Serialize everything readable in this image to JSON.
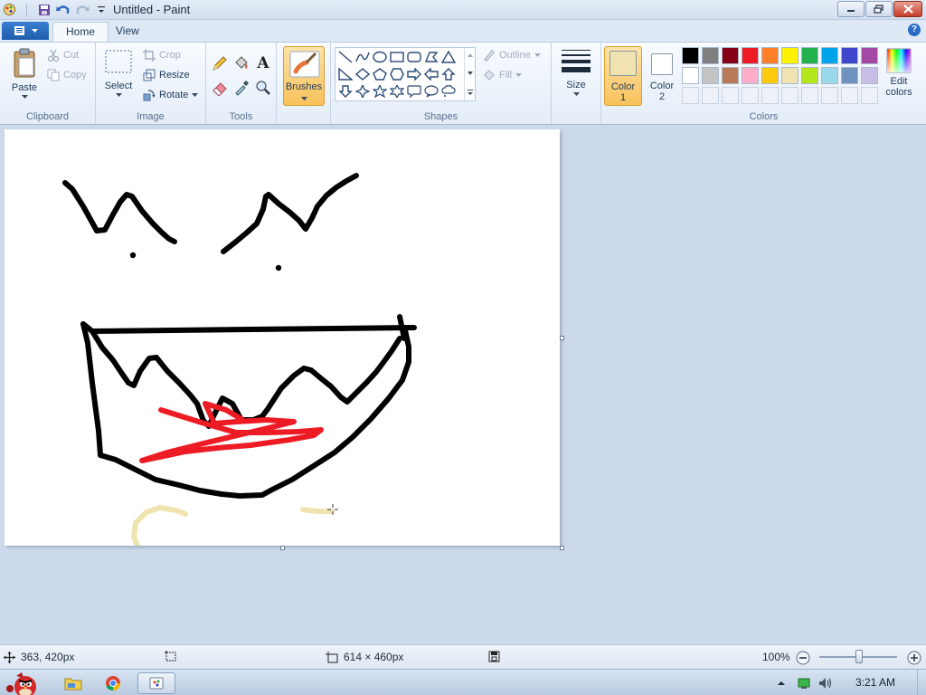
{
  "window": {
    "title": "Untitled - Paint"
  },
  "tabs": {
    "file_icon": "menu-icon",
    "home": "Home",
    "view": "View"
  },
  "clipboard": {
    "paste": "Paste",
    "cut": "Cut",
    "copy": "Copy",
    "group": "Clipboard"
  },
  "image": {
    "select": "Select",
    "crop": "Crop",
    "resize": "Resize",
    "rotate": "Rotate",
    "group": "Image"
  },
  "tools": {
    "group": "Tools",
    "text_tool": "A"
  },
  "brushes": {
    "label": "Brushes"
  },
  "shapes": {
    "outline": "Outline",
    "fill": "Fill",
    "group": "Shapes"
  },
  "size": {
    "label": "Size"
  },
  "colors": {
    "color1_label": "Color",
    "color1_num": "1",
    "color2_label": "Color",
    "color2_num": "2",
    "edit_label": "Edit",
    "edit_label2": "colors",
    "group": "Colors",
    "color1_value": "#efe4b0",
    "color2_value": "#ffffff",
    "palette_row1": [
      "#000000",
      "#7f7f7f",
      "#880015",
      "#ed1c24",
      "#ff7f27",
      "#fff200",
      "#22b14c",
      "#00a2e8",
      "#3f48cc",
      "#a349a4"
    ],
    "palette_row2": [
      "#ffffff",
      "#c3c3c3",
      "#b97a57",
      "#ffaec9",
      "#ffc90e",
      "#efe4b0",
      "#b5e61d",
      "#99d9ea",
      "#7092be",
      "#c8bfe7"
    ]
  },
  "status": {
    "cursor_pos": "363, 420px",
    "canvas_size": "614 × 460px",
    "zoom": "100%"
  },
  "taskbar": {
    "clock": "3:21 AM"
  }
}
